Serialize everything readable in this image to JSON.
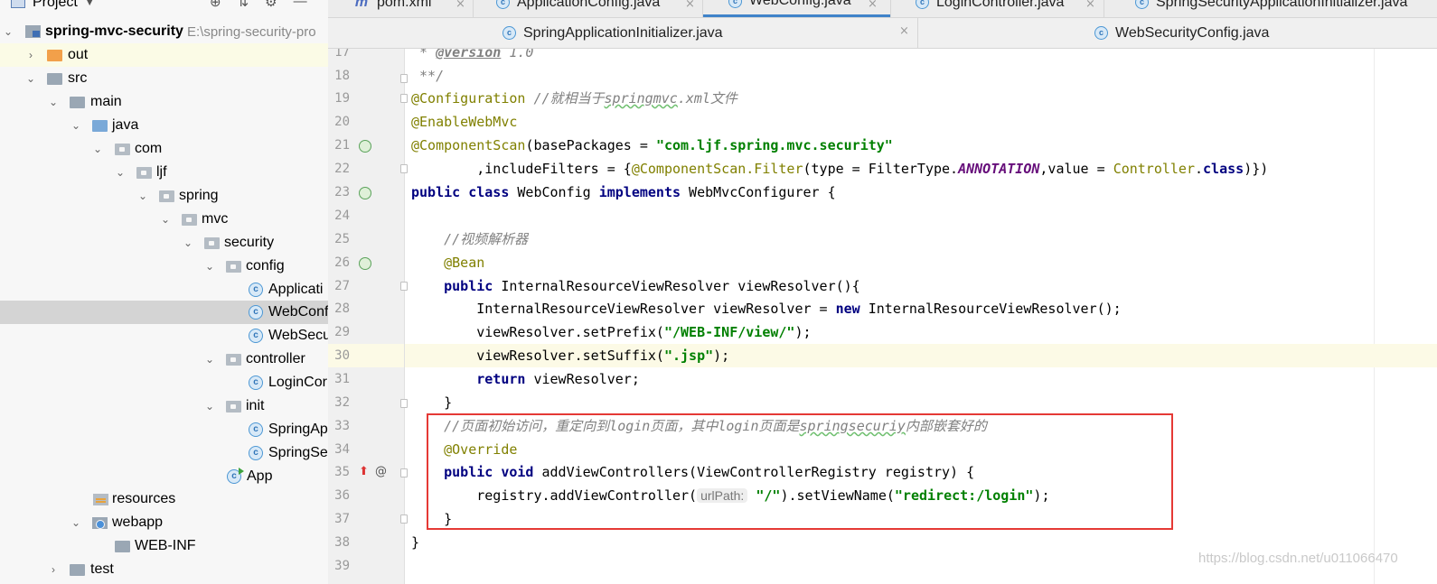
{
  "project_panel": {
    "title": "Project",
    "caret": "▼",
    "tool_icons": [
      "target-icon",
      "collapse-icon",
      "gear-icon",
      "minimize-icon"
    ],
    "tools_glyphs": [
      "⊕",
      "⇅",
      "⚙",
      "—"
    ]
  },
  "tree": {
    "module_name": "spring-mvc-security",
    "module_path": "E:\\spring-security-pro",
    "items": [
      {
        "label": "out",
        "icon": "folder-orange",
        "arrow": "›"
      },
      {
        "label": "src",
        "icon": "folder",
        "arrow": "⌄"
      },
      {
        "label": "main",
        "icon": "folder",
        "arrow": "⌄"
      },
      {
        "label": "java",
        "icon": "folder-blue",
        "arrow": "⌄"
      },
      {
        "label": "com",
        "icon": "package",
        "arrow": "⌄"
      },
      {
        "label": "ljf",
        "icon": "package",
        "arrow": "⌄"
      },
      {
        "label": "spring",
        "icon": "package",
        "arrow": "⌄"
      },
      {
        "label": "mvc",
        "icon": "package",
        "arrow": "⌄"
      },
      {
        "label": "security",
        "icon": "package",
        "arrow": "⌄"
      },
      {
        "label": "config",
        "icon": "package",
        "arrow": "⌄"
      },
      {
        "label": "Applicati",
        "icon": "class"
      },
      {
        "label": "WebConf",
        "icon": "class"
      },
      {
        "label": "WebSecu",
        "icon": "class"
      },
      {
        "label": "controller",
        "icon": "package",
        "arrow": "⌄"
      },
      {
        "label": "LoginCor",
        "icon": "class"
      },
      {
        "label": "init",
        "icon": "package",
        "arrow": "⌄"
      },
      {
        "label": "SpringAp",
        "icon": "class"
      },
      {
        "label": "SpringSe",
        "icon": "class"
      },
      {
        "label": "App",
        "icon": "class-run"
      },
      {
        "label": "resources",
        "icon": "resources-folder"
      },
      {
        "label": "webapp",
        "icon": "webapp-folder",
        "arrow": "⌄"
      },
      {
        "label": "WEB-INF",
        "icon": "folder"
      },
      {
        "label": "test",
        "icon": "folder",
        "arrow": "›"
      }
    ]
  },
  "tabs_row1": [
    {
      "label": "pom.xml",
      "icon": "maven-icon",
      "glyph": "m"
    },
    {
      "label": "ApplicationConfig.java",
      "icon": "class-icon",
      "glyph": "c"
    },
    {
      "label": "WebConfig.java",
      "icon": "class-icon",
      "glyph": "c",
      "active": true
    },
    {
      "label": "LoginController.java",
      "icon": "class-icon",
      "glyph": "c"
    },
    {
      "label": "SpringSecurityApplicationInitializer.java",
      "icon": "class-icon",
      "glyph": "c"
    }
  ],
  "tabs_row2": [
    {
      "label": "SpringApplicationInitializer.java",
      "icon": "class-icon",
      "glyph": "c"
    },
    {
      "label": "WebSecurityConfig.java",
      "icon": "class-icon",
      "glyph": "c"
    }
  ],
  "close_glyph": "×",
  "editor": {
    "line_numbers": [
      "17",
      "18",
      "19",
      "20",
      "21",
      "22",
      "23",
      "24",
      "25",
      "26",
      "27",
      "28",
      "29",
      "30",
      "31",
      "32",
      "33",
      "34",
      "35",
      "36",
      "37",
      "38",
      "39"
    ],
    "current_line": "30",
    "lines": {
      "l17": {
        "a": " * ",
        "b": "@version",
        "c": " 1.0"
      },
      "l18": " **/",
      "l19": {
        "a": "@Configuration",
        "b": " //就相当于",
        "c": "springmvc",
        "d": ".xml文件"
      },
      "l20": "@EnableWebMvc",
      "l21": {
        "a": "@ComponentScan",
        "b": "(basePackages = ",
        "c": "\"com.ljf.spring.mvc.security\""
      },
      "l22": {
        "a": "        ,includeFilters = {",
        "b": "@ComponentScan.Filter",
        "c": "(type = FilterType.",
        "d": "ANNOTATION",
        "e": ",value = ",
        "f": "Controller",
        "g": ".",
        "h": "class",
        "i": ")})"
      },
      "l23": {
        "a": "public class",
        "b": " WebConfig ",
        "c": "implements",
        "d": " WebMvcConfigurer {"
      },
      "l25": "    //视频解析器",
      "l26": "    @Bean",
      "l27": {
        "a": "    public",
        "b": " InternalResourceViewResolver viewResolver(){"
      },
      "l28": {
        "a": "        InternalResourceViewResolver viewResolver = ",
        "b": "new",
        "c": " InternalResourceViewResolver();"
      },
      "l29": {
        "a": "        viewResolver.setPrefix(",
        "b": "\"/WEB-INF/view/\"",
        "c": ");"
      },
      "l30": {
        "a": "        viewResolver.setSuffix(",
        "b": "\".jsp\"",
        "c": ");"
      },
      "l31": {
        "a": "        ",
        "b": "return",
        "c": " viewResolver;"
      },
      "l32": "    }",
      "l33": {
        "a": "    //页面初始访问，重定向到login页面，其中login页面是",
        "b": "springsecuriy",
        "c": "内部嵌套好的"
      },
      "l34": "    @Override",
      "l35": {
        "a": "    public void",
        "b": " addViewControllers(ViewControllerRegistry registry) {"
      },
      "l36": {
        "a": "        registry.addViewController(",
        "hint": "urlPath:",
        "b": "\"/\"",
        "c": ").setViewName(",
        "d": "\"redirect:/login\"",
        "e": ");"
      },
      "l37": "    }",
      "l38": "}"
    }
  },
  "watermark": "https://blog.csdn.net/u011066470"
}
